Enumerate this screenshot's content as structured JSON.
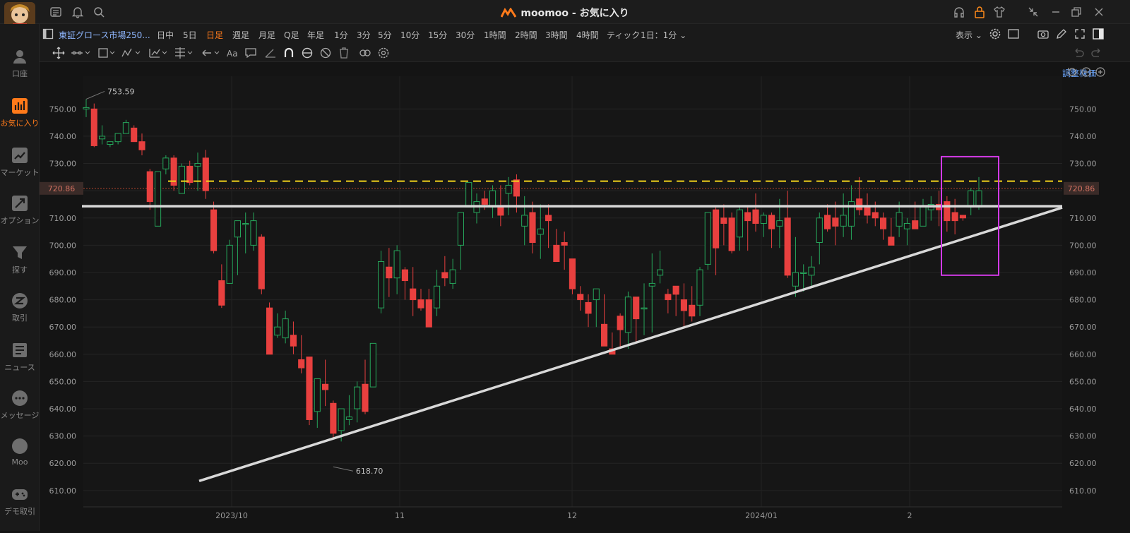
{
  "window": {
    "app_title": "moomoo - お気に入り"
  },
  "sidebar": {
    "items": [
      {
        "label": "口座",
        "icon": "account-icon"
      },
      {
        "label": "お気に入り",
        "icon": "favorites-icon"
      },
      {
        "label": "マーケット",
        "icon": "market-icon"
      },
      {
        "label": "オプション",
        "icon": "options-icon"
      },
      {
        "label": "探す",
        "icon": "filter-icon"
      },
      {
        "label": "取引",
        "icon": "trade-icon"
      },
      {
        "label": "ニュース",
        "icon": "news-icon"
      },
      {
        "label": "メッセージ",
        "icon": "message-icon"
      },
      {
        "label": "Moo",
        "icon": "moo-icon"
      },
      {
        "label": "デモ取引",
        "icon": "demo-trade-icon"
      }
    ]
  },
  "toolbar": {
    "symbol": "東証グロース市場250...",
    "timeframes": [
      "日中",
      "5日",
      "日足",
      "週足",
      "月足",
      "Q足",
      "年足",
      "1分",
      "3分",
      "5分",
      "10分",
      "15分",
      "30分",
      "1時間",
      "2時間",
      "3時間",
      "4時間",
      "ティック"
    ],
    "active_timeframe": "日足",
    "interval_select": "1日：1分",
    "display_label": "表示",
    "adjust_label": "調整株価"
  },
  "chart_data": {
    "type": "candlestick",
    "x_labels": [
      "2023/10",
      "11",
      "12",
      "2024/01",
      "2"
    ],
    "y_ticks": [
      "750.00",
      "740.00",
      "730.00",
      "720.00",
      "710.00",
      "700.00",
      "690.00",
      "680.00",
      "670.00",
      "660.00",
      "650.00",
      "640.00",
      "630.00",
      "620.00",
      "610.00"
    ],
    "ylim": [
      604,
      762
    ],
    "current_price": "720.86",
    "high_label": "753.59",
    "low_label": "618.70",
    "up_color": "#26a65b",
    "down_color": "#e8403f",
    "yellow_line_price": 723.5,
    "white_line_price": 714.3,
    "colors": {
      "yellow": "#f2d21b",
      "white": "#d8d8d8",
      "magenta": "#d23ae6",
      "accent": "#ff7a1a"
    },
    "candles": [
      [
        750,
        753.59,
        747,
        750.5
      ],
      [
        750,
        752,
        736,
        736.5
      ],
      [
        739,
        744,
        737,
        740
      ],
      [
        737,
        738,
        736,
        738
      ],
      [
        738,
        741,
        737,
        741
      ],
      [
        741,
        746,
        741,
        745
      ],
      [
        743,
        744,
        738,
        738
      ],
      [
        738,
        741,
        733,
        735
      ],
      [
        727,
        728,
        713,
        716
      ],
      [
        707,
        726,
        707,
        727
      ],
      [
        728,
        733,
        726,
        732
      ],
      [
        732,
        733,
        720,
        722
      ],
      [
        719,
        730,
        719,
        729
      ],
      [
        729,
        731,
        722,
        723
      ],
      [
        729,
        734,
        720,
        730
      ],
      [
        732,
        735,
        717,
        720
      ],
      [
        713,
        716,
        697,
        698
      ],
      [
        687,
        693,
        677,
        678
      ],
      [
        686,
        702,
        686,
        700
      ],
      [
        703,
        707,
        689,
        709
      ],
      [
        708,
        712,
        697,
        708
      ],
      [
        700,
        712,
        698,
        709
      ],
      [
        703,
        704,
        682,
        684
      ],
      [
        677,
        679,
        660,
        660
      ],
      [
        667,
        675,
        666,
        670
      ],
      [
        666,
        676,
        664,
        673
      ],
      [
        667,
        672,
        660,
        663
      ],
      [
        658,
        667,
        653,
        655
      ],
      [
        659,
        659,
        634,
        636
      ],
      [
        639,
        651,
        633,
        651
      ],
      [
        649,
        658,
        641,
        647
      ],
      [
        642,
        643,
        629,
        631
      ],
      [
        632,
        640,
        628,
        640
      ],
      [
        636,
        645,
        634,
        637
      ],
      [
        640,
        650,
        635,
        648
      ],
      [
        649,
        658,
        638,
        639
      ],
      [
        648,
        664,
        648,
        664
      ],
      [
        677,
        698,
        675,
        694
      ],
      [
        692,
        699,
        681,
        688
      ],
      [
        688,
        700,
        682,
        698
      ],
      [
        691,
        692,
        680,
        687
      ],
      [
        684,
        692,
        674,
        680
      ],
      [
        680,
        684,
        676,
        677
      ],
      [
        680,
        684,
        671,
        670
      ],
      [
        677,
        691,
        674,
        685
      ],
      [
        690,
        696,
        685,
        688
      ],
      [
        686,
        695,
        684,
        691
      ],
      [
        700,
        712,
        691,
        712
      ],
      [
        714,
        722,
        714,
        723
      ],
      [
        712,
        719,
        708,
        716
      ],
      [
        717,
        720,
        713,
        715
      ],
      [
        714,
        722,
        710,
        720
      ],
      [
        714,
        722,
        707,
        711
      ],
      [
        719,
        725,
        711,
        722
      ],
      [
        724,
        726,
        712,
        718
      ],
      [
        707,
        718,
        700,
        711
      ],
      [
        712,
        716,
        697,
        701
      ],
      [
        704,
        715,
        695,
        706
      ],
      [
        711,
        715,
        699,
        709
      ],
      [
        700,
        706,
        694,
        694
      ],
      [
        701,
        705,
        691,
        700
      ],
      [
        695,
        694,
        682,
        684
      ],
      [
        682,
        685,
        676,
        680
      ],
      [
        679,
        682,
        670,
        675
      ],
      [
        680,
        683,
        670,
        684
      ],
      [
        671,
        682,
        663,
        663
      ],
      [
        662,
        668,
        660,
        660
      ],
      [
        674,
        675,
        662,
        669
      ],
      [
        668,
        683,
        662,
        681
      ],
      [
        681,
        680,
        664,
        673
      ],
      [
        677,
        686,
        667,
        677
      ],
      [
        685,
        697,
        668,
        686
      ],
      [
        689,
        698,
        686,
        691
      ],
      [
        682,
        684,
        675,
        680
      ],
      [
        685,
        683,
        674,
        682
      ],
      [
        680,
        686,
        670,
        676
      ],
      [
        678,
        685,
        672,
        674
      ],
      [
        678,
        692,
        674,
        691
      ],
      [
        693,
        712,
        691,
        712
      ],
      [
        713,
        714,
        689,
        699
      ],
      [
        710,
        715,
        700,
        708
      ],
      [
        710,
        712,
        697,
        698
      ],
      [
        703,
        714,
        698,
        713
      ],
      [
        712,
        714,
        698,
        709
      ],
      [
        713,
        719,
        705,
        708
      ],
      [
        708,
        712,
        703,
        711
      ],
      [
        711,
        712,
        699,
        706
      ],
      [
        707,
        717,
        699,
        709
      ],
      [
        710,
        720,
        688,
        689
      ],
      [
        685,
        703,
        681,
        690
      ],
      [
        690,
        693,
        683,
        690
      ],
      [
        689,
        696,
        685,
        692
      ],
      [
        701,
        712,
        693,
        710
      ],
      [
        711,
        715,
        705,
        706
      ],
      [
        710,
        716,
        700,
        707
      ],
      [
        707,
        719,
        703,
        711
      ],
      [
        707,
        722,
        702,
        716
      ],
      [
        717,
        725,
        711,
        713
      ],
      [
        714,
        719,
        708,
        711
      ],
      [
        712,
        716,
        707,
        710
      ],
      [
        710,
        712,
        702,
        706
      ],
      [
        703,
        710,
        700,
        700
      ],
      [
        707,
        716,
        703,
        712
      ],
      [
        706,
        710,
        700,
        708
      ],
      [
        709,
        716,
        706,
        706
      ],
      [
        707,
        717,
        707,
        714
      ],
      [
        713,
        718,
        709,
        715
      ],
      [
        715,
        720,
        707,
        713
      ],
      [
        716,
        718,
        705,
        709
      ],
      [
        712,
        717,
        704,
        709
      ],
      [
        711,
        711,
        709,
        710
      ],
      [
        714,
        721,
        711,
        720
      ],
      [
        714,
        725,
        713,
        720
      ]
    ],
    "annotations": {
      "rect_price_top": 732.5,
      "rect_price_bottom": 689
    }
  }
}
